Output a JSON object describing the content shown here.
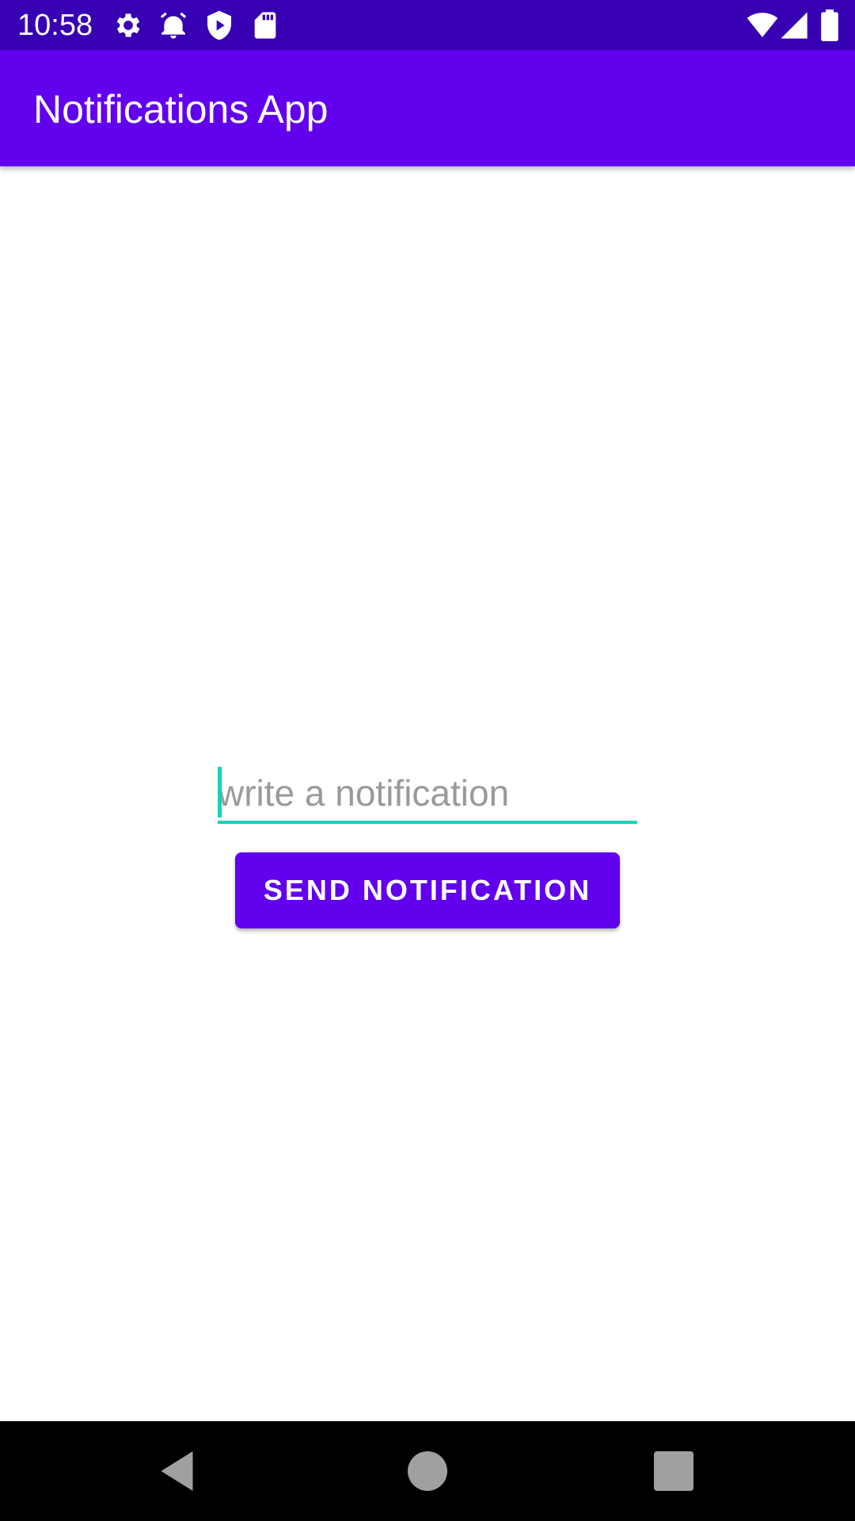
{
  "status_bar": {
    "time": "10:58",
    "icons": [
      "gear-icon",
      "alarm-icon",
      "play-protect-icon",
      "sd-card-icon",
      "wifi-icon",
      "signal-icon",
      "battery-icon"
    ]
  },
  "app_bar": {
    "title": "Notifications App"
  },
  "main": {
    "notification_input": {
      "value": "",
      "placeholder": "write a notification"
    },
    "send_button_label": "SEND NOTIFICATION"
  },
  "nav_bar": {
    "icons": [
      "back-icon",
      "home-icon",
      "recents-icon"
    ]
  },
  "colors": {
    "status_bar": "#3700b3",
    "primary": "#6200ee",
    "accent": "#18d1bc"
  }
}
